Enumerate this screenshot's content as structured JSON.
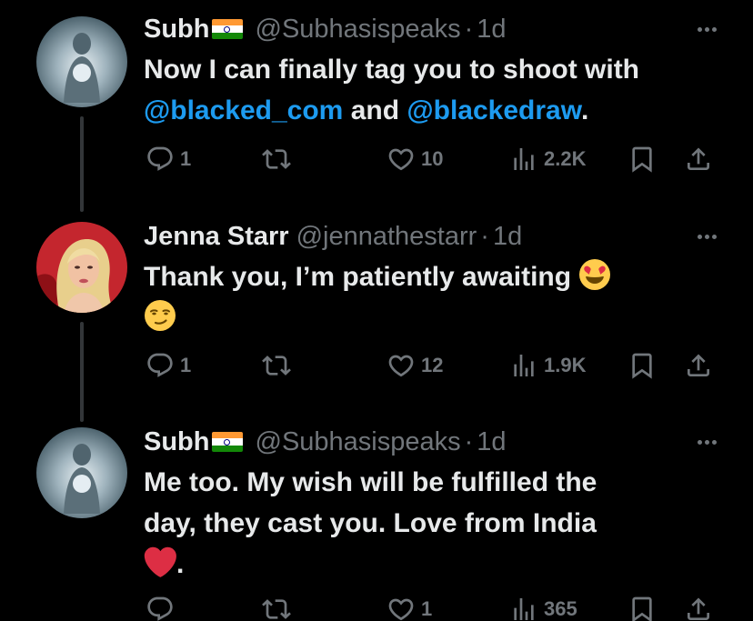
{
  "tweets": [
    {
      "name": "Subh",
      "handle": "@Subhasispeaks",
      "sep": "·",
      "time": "1d",
      "text_parts": [
        "Now I can finally tag you to shoot with ",
        "@blacked_com",
        " and ",
        "@blackedraw",
        "."
      ],
      "replies": "1",
      "retweets": "",
      "likes": "10",
      "views": "2.2K"
    },
    {
      "name": "Jenna Starr",
      "handle": "@jennathestarr",
      "sep": "·",
      "time": "1d",
      "text_line1": "Thank you, I’m patiently awaiting",
      "replies": "1",
      "retweets": "",
      "likes": "12",
      "views": "1.9K"
    },
    {
      "name": "Subh",
      "handle": "@Subhasispeaks",
      "sep": "·",
      "time": "1d",
      "text_line1": "Me too. My wish will be fulfilled the",
      "text_line2": "day, they cast you. Love from India",
      "text_line3": ".",
      "replies": "",
      "retweets": "",
      "likes": "1",
      "views": "365"
    }
  ],
  "icons": {
    "reply": "reply-icon",
    "retweet": "retweet-icon",
    "like": "heart-icon",
    "views": "views-icon",
    "bookmark": "bookmark-icon",
    "share": "share-icon",
    "more": "more-icon",
    "flag": "india-flag-icon",
    "heart_eyes": "heart-eyes-emoji",
    "smirk": "smirk-emoji",
    "red_heart": "red-heart-emoji"
  },
  "colors": {
    "background": "#000000",
    "text": "#e7e9ea",
    "secondary": "#71767b",
    "link": "#1d9bf0",
    "thread_line": "#333639"
  }
}
